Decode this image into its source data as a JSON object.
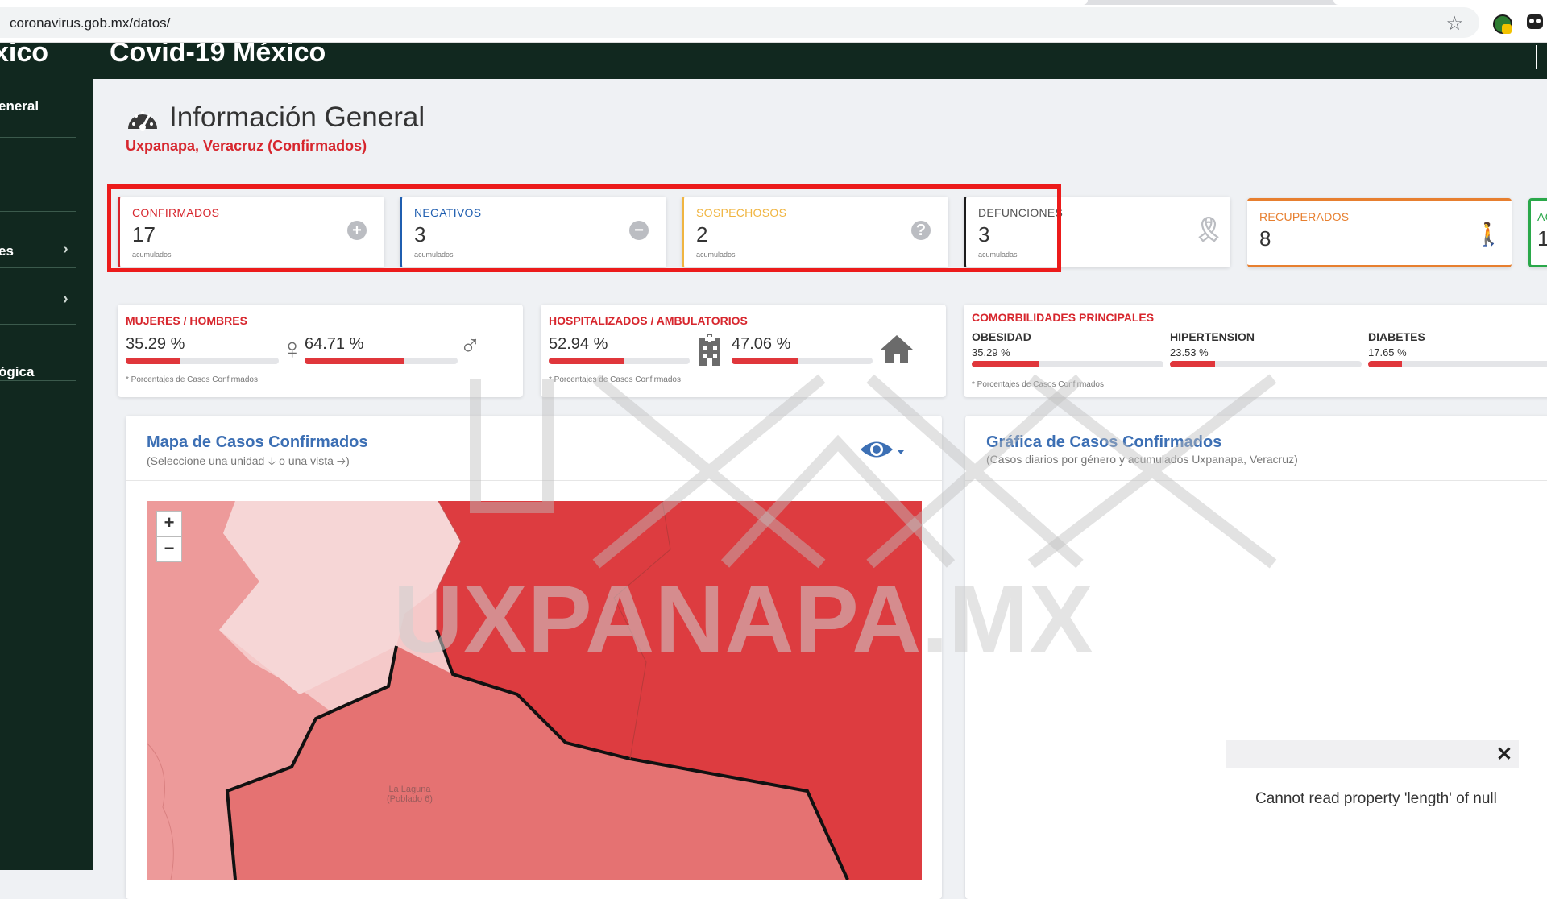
{
  "browser": {
    "url": "coronavirus.gob.mx/datos/"
  },
  "header": {
    "brand": "xico",
    "title": "Covid-19 México"
  },
  "sidebar": {
    "items": [
      {
        "label": "eneral",
        "chevron": false
      },
      {
        "label": "",
        "chevron": false
      },
      {
        "label": "es",
        "chevron": true
      },
      {
        "label": "",
        "chevron": true
      },
      {
        "label": "ógica",
        "chevron": false
      }
    ]
  },
  "page": {
    "title": "Información General",
    "subtitle": "Uxpanapa, Veracruz (Confirmados)"
  },
  "stats": [
    {
      "label": "CONFIRMADOS",
      "value": "17",
      "unit": "acumulados",
      "color": "#d7262d"
    },
    {
      "label": "NEGATIVOS",
      "value": "3",
      "unit": "acumulados",
      "color": "#1f5eb0"
    },
    {
      "label": "SOSPECHOSOS",
      "value": "2",
      "unit": "acumulados",
      "color": "#f0b541"
    },
    {
      "label": "DEFUNCIONES",
      "value": "3",
      "unit": "acumuladas",
      "color": "#1c1c1c"
    },
    {
      "label": "RECUPERADOS",
      "value": "8",
      "unit": "",
      "color": "#e77f2f"
    },
    {
      "label": "AC",
      "value": "1",
      "unit": "",
      "color": "#2aa84a"
    }
  ],
  "gender": {
    "title": "MUJERES / HOMBRES",
    "women_pct": "35.29 %",
    "women_value": 35.29,
    "men_pct": "64.71 %",
    "men_value": 64.71,
    "note": "* Porcentajes  de Casos Confirmados"
  },
  "hospital": {
    "title": "HOSPITALIZADOS / AMBULATORIOS",
    "hosp_pct": "52.94 %",
    "hosp_value": 52.94,
    "amb_pct": "47.06 %",
    "amb_value": 47.06,
    "note": "* Porcentajes  de Casos Confirmados"
  },
  "comorbidities": {
    "title": "COMORBILIDADES PRINCIPALES",
    "items": [
      {
        "label": "OBESIDAD",
        "pct": "35.29 %",
        "value": 35.29
      },
      {
        "label": "HIPERTENSION",
        "pct": "23.53 %",
        "value": 23.53
      },
      {
        "label": "DIABETES",
        "pct": "17.65 %",
        "value": 17.65
      }
    ],
    "note": "* Porcentajes  de Casos Confirmados"
  },
  "map": {
    "title": "Mapa de Casos Confirmados",
    "subtitle": "(Seleccione una unidad 🡣 o una vista 🡢)",
    "zoom_in": "+",
    "zoom_out": "−",
    "place_label_1": "La Laguna",
    "place_label_2": "(Poblado 6)"
  },
  "chart": {
    "title": "Gráfica de Casos Confirmados",
    "subtitle": "(Casos diarios por género y acumulados Uxpanapa, Veracruz)",
    "error_close": "✕",
    "error": "Cannot read property 'length' of null"
  },
  "watermark": {
    "text": "UXPANAPA.MX"
  },
  "colors": {
    "sidebar": "#11281f",
    "accent_red": "#d7262d",
    "link_blue": "#3c6fb4",
    "highlight": "#ec1b1b"
  }
}
